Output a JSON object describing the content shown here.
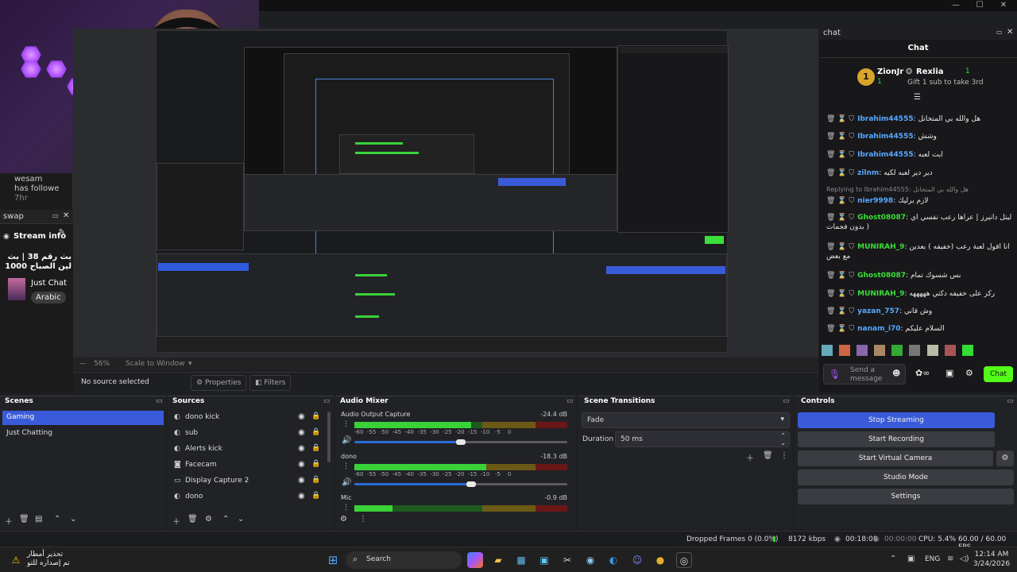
{
  "window": {
    "minimize": "—",
    "maximize": "☐",
    "close": "✕"
  },
  "follow": {
    "user": "wesam",
    "text": "has followe",
    "time": "7hr"
  },
  "swap_panel": {
    "title": "swap",
    "stream_info_label": "Stream info",
    "stream_title": "بث رقم 38 | بث لين الصباح 1000",
    "category": "Just Chat",
    "language": "Arabic"
  },
  "preview": {
    "zoom": "56%",
    "scale_mode": "Scale to Window",
    "no_source": "No source selected",
    "properties": "Properties",
    "filters": "Filters"
  },
  "chat": {
    "dock_title": "chat",
    "header": "Chat",
    "leader1": {
      "name": "ZionJr",
      "count": "1"
    },
    "leader2": {
      "name": "Rexlia",
      "count": "1",
      "sub": "Gift 1 sub to take 3rd"
    },
    "messages": [
      {
        "user": "Ibrahim44555",
        "text": "هل والله بي المتخانل",
        "color": "#59a8ff"
      },
      {
        "user": "Ibrahim44555",
        "text": "وشش",
        "color": "#59a8ff"
      },
      {
        "user": "Ibrahim44555",
        "text": "ايت لعبه",
        "color": "#59a8ff"
      },
      {
        "user": "zilnm",
        "text": "دير دير لعبه لكيه",
        "color": "#59a8ff"
      },
      {
        "user": "nier9998",
        "text": "لازم برليك",
        "color": "#59a8ff",
        "reply": "Replying to Ibrahim44555: هل والله بي المتخانل"
      },
      {
        "user": "Ghost08087",
        "text": "ليتل دانيرز | عراها رعب نفسي اي بدون فجمات )",
        "color": "#3adf3a"
      },
      {
        "user": "MUNIRAH_9",
        "text": "انا اقول لعبة رعب (خفيفه ) بعدين مع بعض",
        "color": "#3adf3a"
      },
      {
        "user": "Ghost08087",
        "text": "بس شسوك تمام",
        "color": "#3adf3a"
      },
      {
        "user": "MUNIRAH_9",
        "text": "ركز على خفيفه دكتي هههههه",
        "color": "#3adf3a"
      },
      {
        "user": "yazan_757",
        "text": "وش قاني",
        "color": "#59a8ff"
      },
      {
        "user": "nanam_i70",
        "text": "السلام عليكم",
        "color": "#59a8ff"
      }
    ],
    "send_placeholder": "Send a message",
    "chat_button": "Chat"
  },
  "docks": {
    "scenes": {
      "title": "Scenes",
      "items": [
        "Gaming",
        "Just Chatting"
      ],
      "selected": 0
    },
    "sources": {
      "title": "Sources",
      "items": [
        "dono kick",
        "sub",
        "Alerts kick",
        "Facecam",
        "Display Capture 2",
        "dono"
      ]
    },
    "audio": {
      "title": "Audio Mixer",
      "channels": [
        {
          "name": "Audio Output Capture",
          "db": "-24.4 dB",
          "level": 0.55,
          "vol": 0.5
        },
        {
          "name": "dono",
          "db": "-18.3 dB",
          "level": 0.62,
          "vol": 0.55
        },
        {
          "name": "Mic",
          "db": "-0.9 dB",
          "level": 0.18,
          "vol": 0.0
        }
      ],
      "ticks": "-60  -55  -50  -45  -40  -35  -30  -25  -20  -15  -10   -5    0"
    },
    "transitions": {
      "title": "Scene Transitions",
      "selected": "Fade",
      "duration_label": "Duration",
      "duration": "50 ms"
    },
    "controls": {
      "title": "Controls",
      "buttons": [
        "Stop Streaming",
        "Start Recording",
        "Start Virtual Camera",
        "Studio Mode",
        "Settings"
      ]
    }
  },
  "status": {
    "dropped": "Dropped Frames 0 (0.0%)",
    "bitrate": "8172 kbps",
    "live_time": "00:18:08",
    "rec_time": "00:00:00",
    "cpu": "CPU: 5.4%",
    "fps": "60.00 / 60.00 FPS"
  },
  "taskbar": {
    "weather_line1": "تحذير أمطار",
    "weather_line2": "تم إصداره للتو",
    "search": "Search",
    "lang": "ENG",
    "time": "12:14 AM",
    "date": "3/24/2026"
  }
}
